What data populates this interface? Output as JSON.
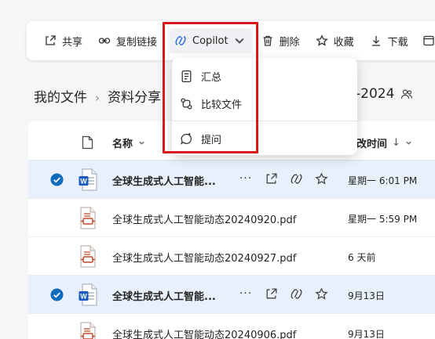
{
  "toolbar": {
    "share": "共享",
    "copy_link": "复制链接",
    "copilot": "Copilot",
    "delete": "删除",
    "favorite": "收藏",
    "download": "下载"
  },
  "breadcrumb": {
    "root": "我的文件",
    "folder": "资料分享",
    "tail": "-2024"
  },
  "list_header": {
    "name": "名称",
    "modified": "改时间",
    "sort_arrow": "↓"
  },
  "files": [
    {
      "name": "全球生成式人工智能...",
      "date": "星期一 6:01 PM",
      "type": "word",
      "selected": true
    },
    {
      "name": "全球生成式人工智能动态20240920.pdf",
      "date": "星期一 5:59 PM",
      "type": "pdf",
      "selected": false
    },
    {
      "name": "全球生成式人工智能动态20240927.pdf",
      "date": "6 天前",
      "type": "pdf",
      "selected": false
    },
    {
      "name": "全球生成式人工智能...",
      "date": "9月13日",
      "type": "word",
      "selected": true
    },
    {
      "name": "全球生成式人工智能动态20240906.pdf",
      "date": "9月13日",
      "type": "pdf",
      "selected": false
    }
  ],
  "row_actions": {
    "more": "···"
  },
  "copilot_menu": {
    "summary": "汇总",
    "compare": "比较文件",
    "ask": "提问"
  },
  "colors": {
    "accent": "#0f6cbd",
    "selected_row": "#e8f0fb",
    "highlight": "#d7191c",
    "word_blue": "#185abd",
    "pdf_red": "#c4472a"
  }
}
